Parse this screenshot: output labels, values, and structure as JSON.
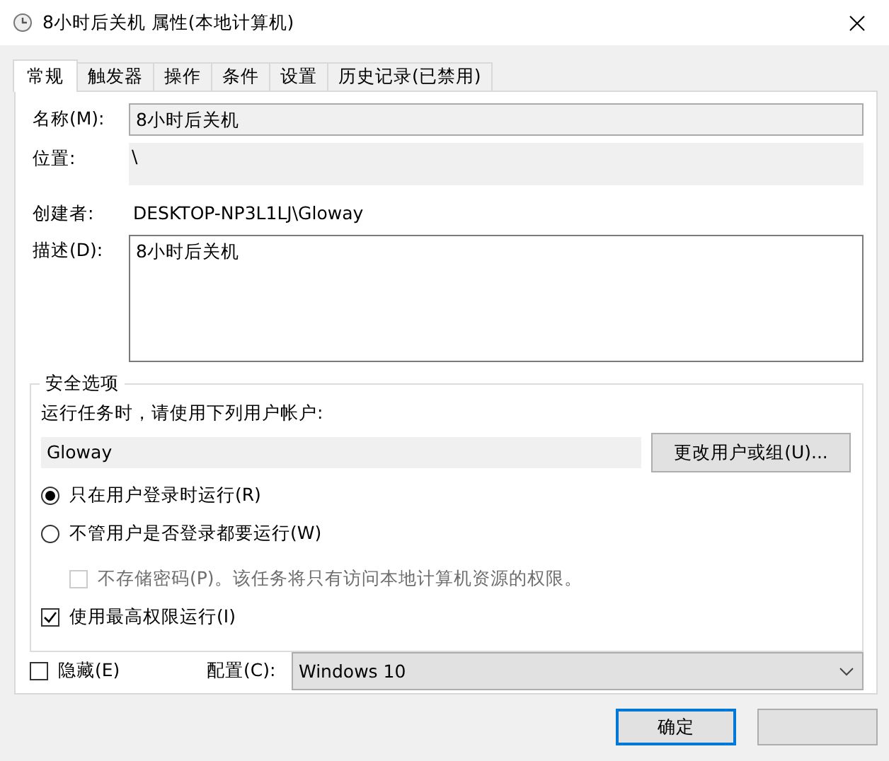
{
  "window": {
    "title": "8小时后关机 属性(本地计算机)"
  },
  "tabs": [
    {
      "label": "常规",
      "selected": true
    },
    {
      "label": "触发器",
      "selected": false
    },
    {
      "label": "操作",
      "selected": false
    },
    {
      "label": "条件",
      "selected": false
    },
    {
      "label": "设置",
      "selected": false
    },
    {
      "label": "历史记录(已禁用)",
      "selected": false
    }
  ],
  "general": {
    "name": {
      "label": "名称(M):",
      "value": "8小时后关机"
    },
    "location": {
      "label": "位置:",
      "value": "\\"
    },
    "author": {
      "label": "创建者:",
      "value": "DESKTOP-NP3L1LJ\\Gloway"
    },
    "description": {
      "label": "描述(D):",
      "value": "8小时后关机"
    }
  },
  "security": {
    "legend": "安全选项",
    "run_as_label": "运行任务时，请使用下列用户帐户:",
    "account": "Gloway",
    "change_button": "更改用户或组(U)...",
    "options": [
      {
        "kind": "radio",
        "label": "只在用户登录时运行(R)",
        "selected": true
      },
      {
        "kind": "radio",
        "label": "不管用户是否登录都要运行(W)",
        "selected": false,
        "children": [
          {
            "kind": "checkbox",
            "label": "不存储密码(P)。该任务将只有访问本地计算机资源的权限。",
            "checked": false,
            "disabled": true
          }
        ]
      },
      {
        "kind": "checkbox",
        "label": "使用最高权限运行(I)",
        "checked": true,
        "disabled": false
      }
    ]
  },
  "hidden": {
    "label": "隐藏(E)",
    "checked": false
  },
  "config": {
    "label": "配置(C):",
    "value": "Windows 10"
  },
  "buttons": [
    {
      "label": "确定",
      "default": true
    },
    {
      "default": false
    }
  ]
}
